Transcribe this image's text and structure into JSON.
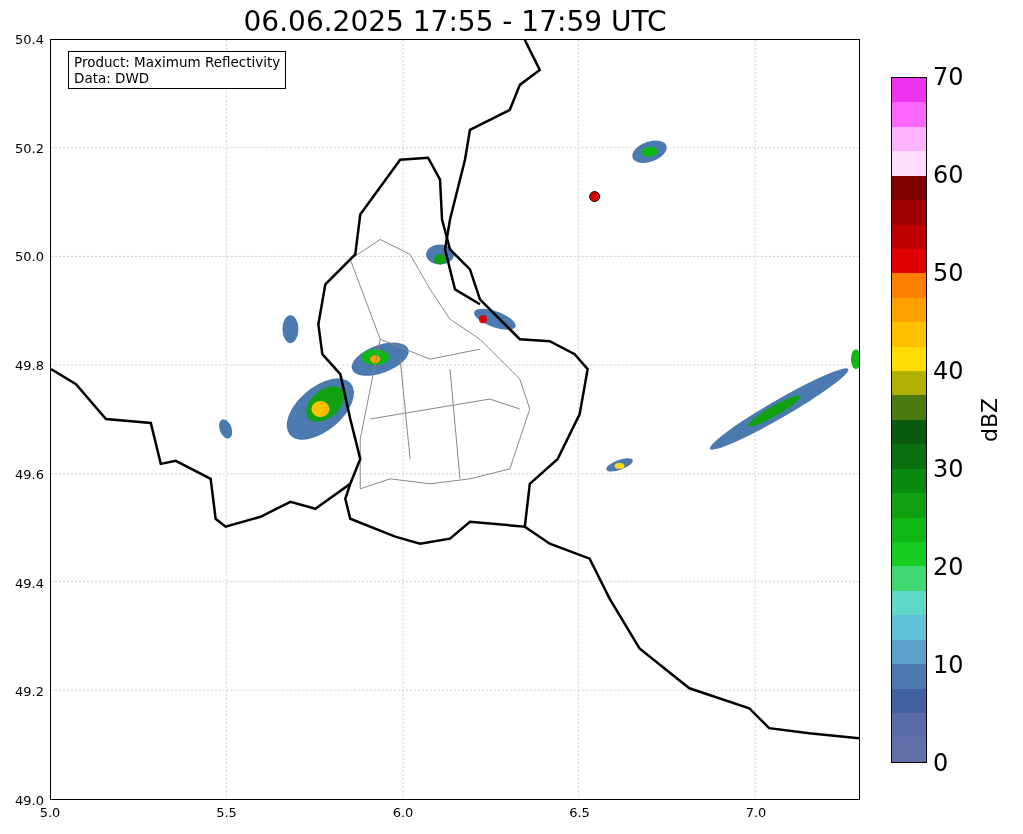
{
  "title": "06.06.2025 17:55 - 17:59 UTC",
  "legend": {
    "lines": [
      "Product: Maximum Reflectivity",
      "Data: DWD"
    ]
  },
  "y_ticks": [
    "50.4",
    "50.2",
    "50.0",
    "49.8",
    "49.6",
    "49.4",
    "49.2",
    "49.0"
  ],
  "x_ticks": [
    "5.0",
    "5.5",
    "6.0",
    "6.5",
    "7.0"
  ],
  "colorbar": {
    "label": "dBZ",
    "ticks": [
      "70",
      "60",
      "50",
      "40",
      "30",
      "20",
      "10",
      "0"
    ],
    "bands": [
      {
        "color": "#ee33ee"
      },
      {
        "color": "#ff66ff"
      },
      {
        "color": "#ffb3ff"
      },
      {
        "color": "#ffddff"
      },
      {
        "color": "#800000"
      },
      {
        "color": "#a00000"
      },
      {
        "color": "#c00000"
      },
      {
        "color": "#e00000"
      },
      {
        "color": "#ff8000"
      },
      {
        "color": "#ffa000"
      },
      {
        "color": "#ffc000"
      },
      {
        "color": "#ffdd00"
      },
      {
        "color": "#b0b000"
      },
      {
        "color": "#4a7a10"
      },
      {
        "color": "#0a5a10"
      },
      {
        "color": "#0a7010"
      },
      {
        "color": "#0a8a10"
      },
      {
        "color": "#10a010"
      },
      {
        "color": "#10b815"
      },
      {
        "color": "#15cc20"
      },
      {
        "color": "#40d870"
      },
      {
        "color": "#60d8c8"
      },
      {
        "color": "#60c0d8"
      },
      {
        "color": "#5aa0c8"
      },
      {
        "color": "#4a7ab0"
      },
      {
        "color": "#4060a0"
      },
      {
        "color": "#5a6ca8"
      },
      {
        "color": "#6070a8"
      }
    ]
  }
}
